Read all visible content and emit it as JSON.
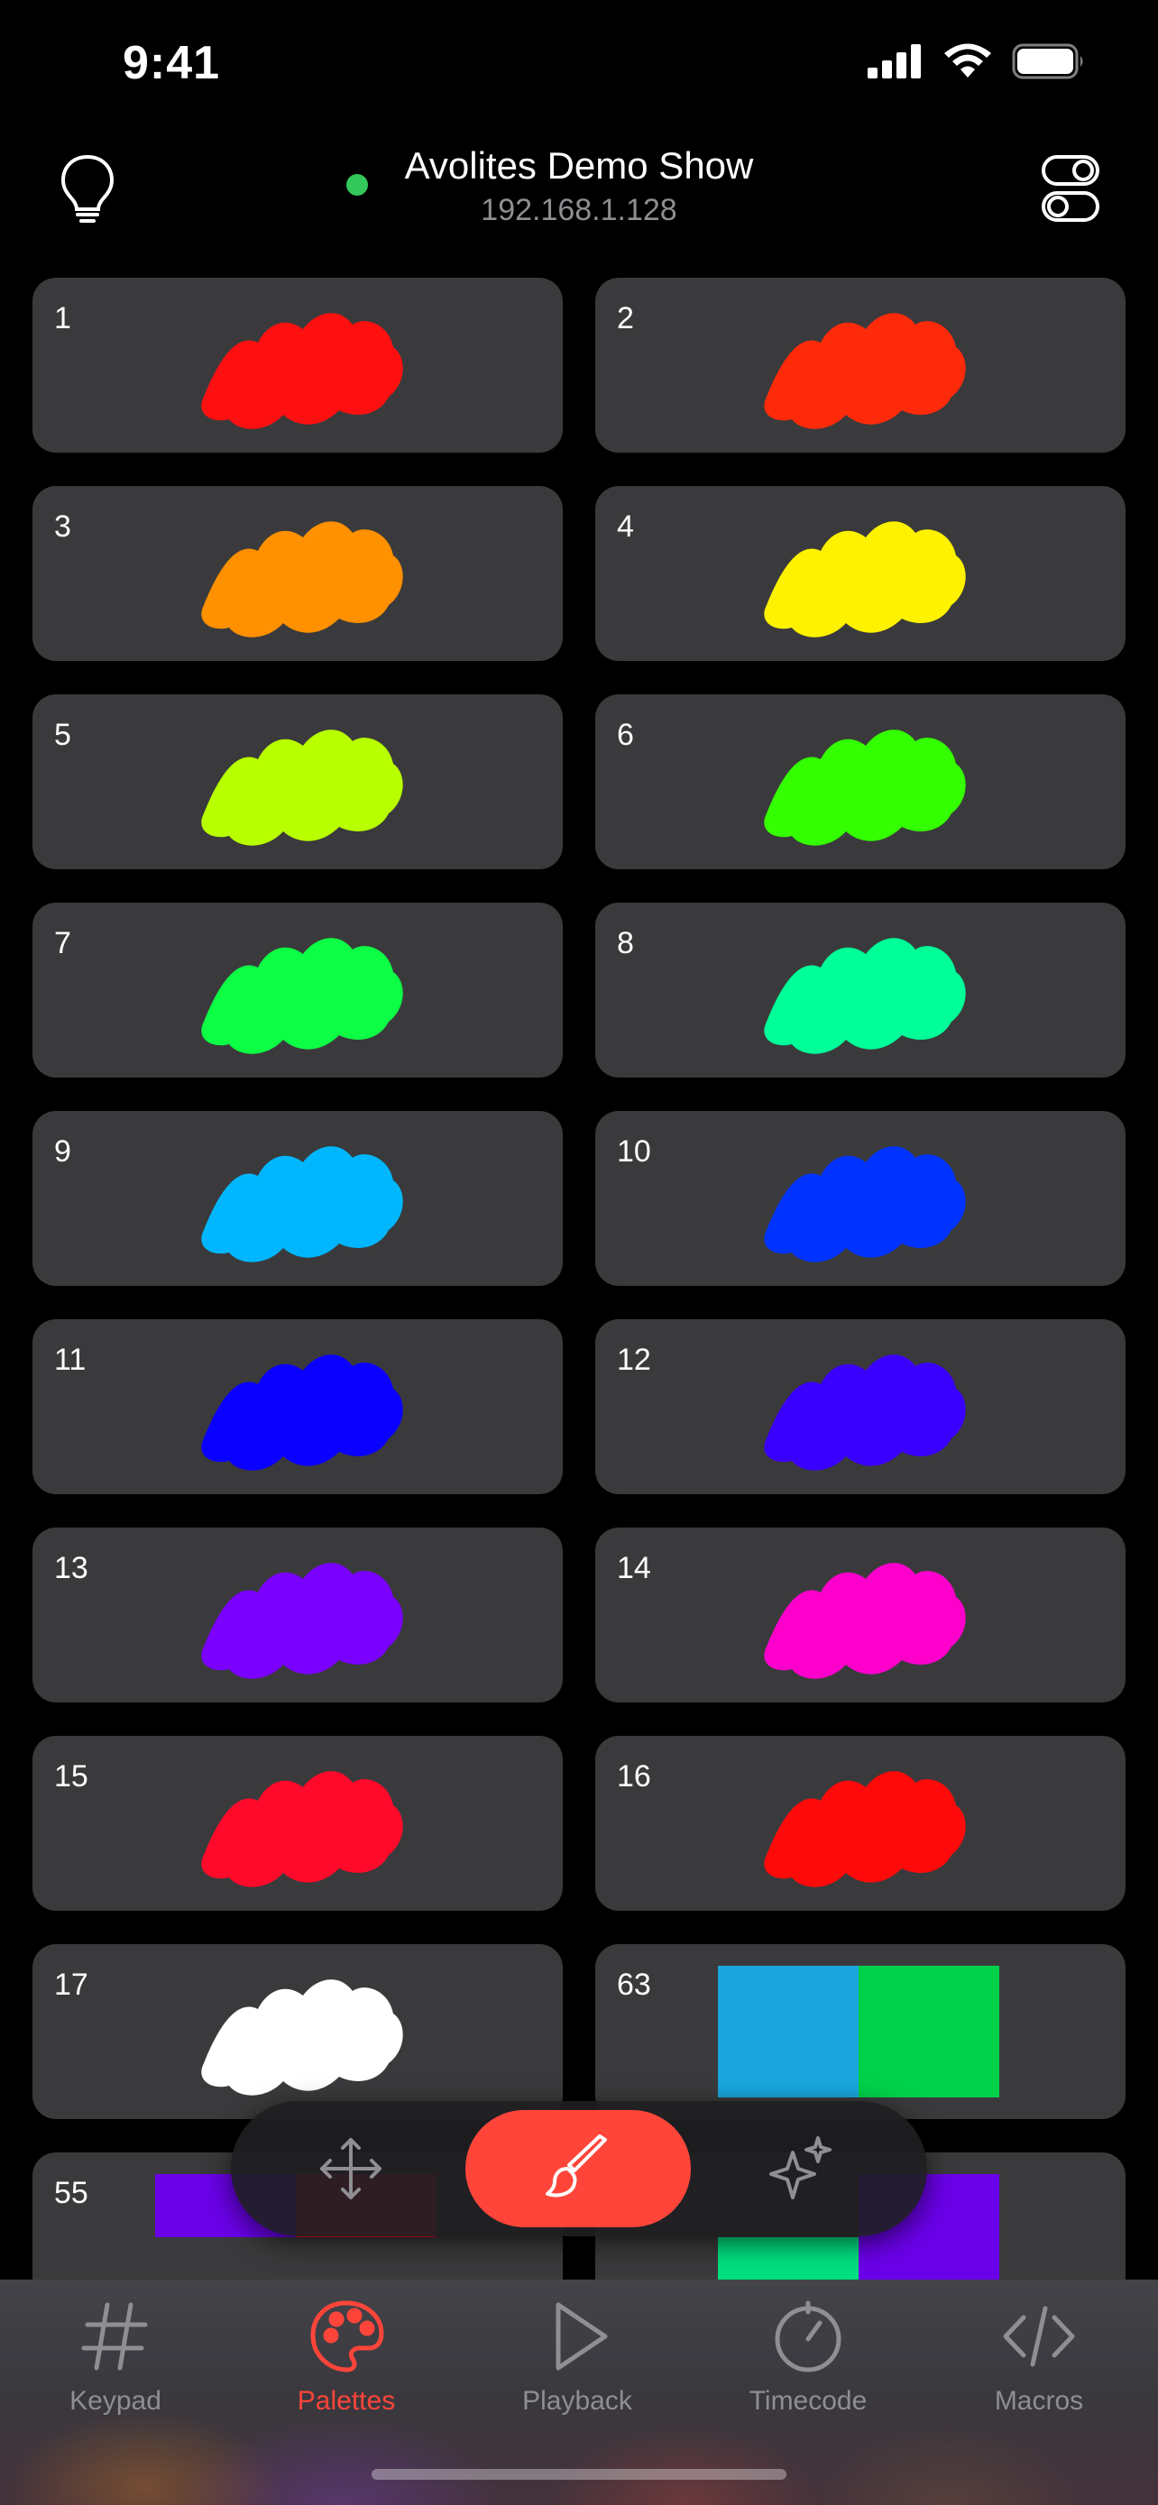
{
  "status_bar": {
    "time": "9:41"
  },
  "header": {
    "show_name": "Avolites Demo Show",
    "ip_address": "192.168.1.128",
    "connection_color": "#34c759"
  },
  "palettes": [
    {
      "label": "1",
      "color": "#ff1010",
      "kind": "color"
    },
    {
      "label": "2",
      "color": "#ff2a0a",
      "kind": "color"
    },
    {
      "label": "3",
      "color": "#ff9000",
      "kind": "color"
    },
    {
      "label": "4",
      "color": "#fff200",
      "kind": "color"
    },
    {
      "label": "5",
      "color": "#b8ff00",
      "kind": "color"
    },
    {
      "label": "6",
      "color": "#33ff00",
      "kind": "color"
    },
    {
      "label": "7",
      "color": "#0dff45",
      "kind": "color"
    },
    {
      "label": "8",
      "color": "#00ff99",
      "kind": "color"
    },
    {
      "label": "9",
      "color": "#00b7ff",
      "kind": "color"
    },
    {
      "label": "10",
      "color": "#0033ff",
      "kind": "color"
    },
    {
      "label": "11",
      "color": "#0a00ff",
      "kind": "color"
    },
    {
      "label": "12",
      "color": "#3a00ff",
      "kind": "color"
    },
    {
      "label": "13",
      "color": "#7a00ff",
      "kind": "color"
    },
    {
      "label": "14",
      "color": "#ff00cc",
      "kind": "color"
    },
    {
      "label": "15",
      "color": "#ff0a2a",
      "kind": "color"
    },
    {
      "label": "16",
      "color": "#ff0a0a",
      "kind": "color"
    },
    {
      "label": "17",
      "color": "#ffffff",
      "kind": "color"
    },
    {
      "label": "63",
      "kind": "split",
      "colors": [
        "#1aa6dd",
        "#00d14a"
      ]
    },
    {
      "label": "55",
      "kind": "split4",
      "colors": [
        "#6a00e8",
        "#e0102e",
        "#3a3a3c",
        "#3a3a3c"
      ]
    },
    {
      "label": "",
      "kind": "split4",
      "colors": [
        "#3a3a3c",
        "#6a00e8",
        "#00e080",
        "#6a00e8"
      ]
    }
  ],
  "toolbar": {
    "items": [
      {
        "name": "position",
        "icon": "move-arrows-icon",
        "active": false
      },
      {
        "name": "colour",
        "icon": "paintbrush-icon",
        "active": true
      },
      {
        "name": "effects",
        "icon": "sparkles-icon",
        "active": false
      }
    ],
    "active_color": "#ff453a"
  },
  "tabs": [
    {
      "label": "Keypad",
      "icon": "hash-icon",
      "active": false
    },
    {
      "label": "Palettes",
      "icon": "palette-icon",
      "active": true
    },
    {
      "label": "Playback",
      "icon": "play-icon",
      "active": false
    },
    {
      "label": "Timecode",
      "icon": "timer-icon",
      "active": false
    },
    {
      "label": "Macros",
      "icon": "code-icon",
      "active": false
    }
  ]
}
